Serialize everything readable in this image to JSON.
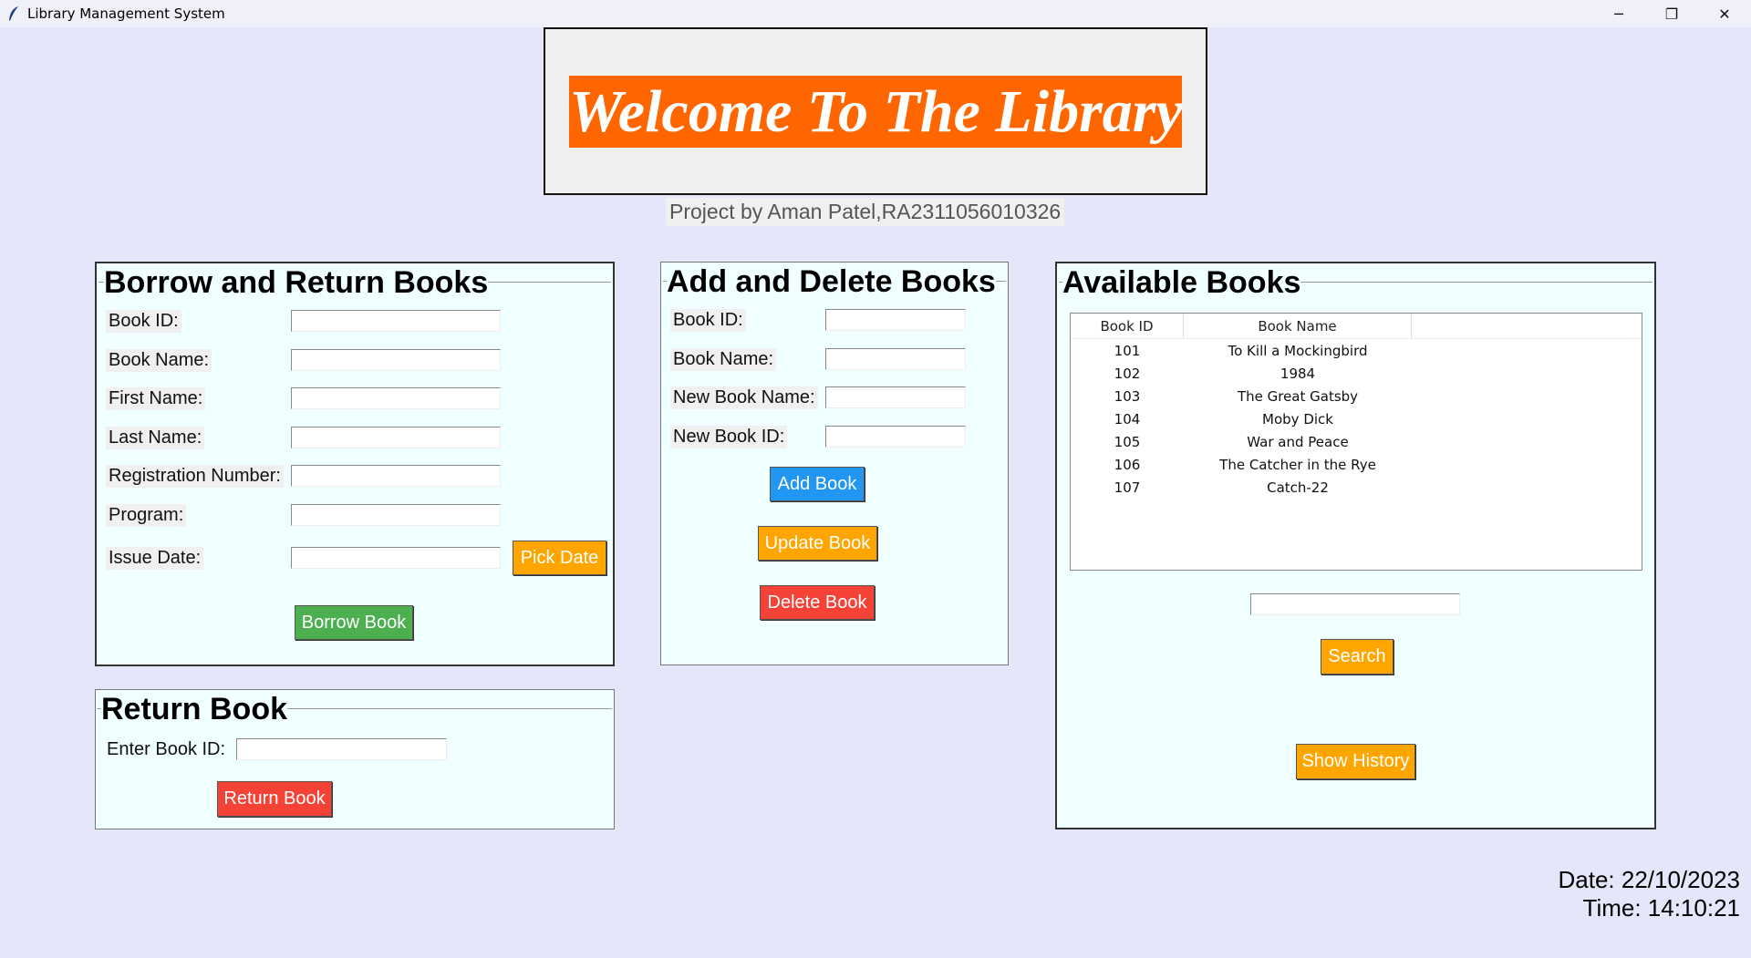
{
  "window": {
    "title": "Library Management System",
    "controls": {
      "minimize": "─",
      "restore": "❐",
      "close": "✕"
    }
  },
  "banner": {
    "title": "Welcome To The Library",
    "subtitle": "Project by Aman Patel,RA2311056010326"
  },
  "borrow_return": {
    "title": "Borrow and Return Books",
    "labels": {
      "book_id": "Book ID:",
      "book_name": "Book Name:",
      "first_name": "First Name:",
      "last_name": "Last Name:",
      "registration_number": "Registration Number:",
      "program": "Program:",
      "issue_date": "Issue Date:"
    },
    "values": {
      "book_id": "",
      "book_name": "",
      "first_name": "",
      "last_name": "",
      "registration_number": "",
      "program": "",
      "issue_date": ""
    },
    "pick_date_button": "Pick Date",
    "borrow_button": "Borrow Book"
  },
  "return_book": {
    "title": "Return Book",
    "label": "Enter Book ID:",
    "value": "",
    "button": "Return Book"
  },
  "add_delete": {
    "title": "Add and Delete Books",
    "labels": {
      "book_id": "Book ID:",
      "book_name": "Book Name:",
      "new_book_name": "New Book Name:",
      "new_book_id": "New Book ID:"
    },
    "values": {
      "book_id": "",
      "book_name": "",
      "new_book_name": "",
      "new_book_id": ""
    },
    "add_button": "Add Book",
    "update_button": "Update Book",
    "delete_button": "Delete Book"
  },
  "available_books": {
    "title": "Available Books",
    "columns": [
      "Book ID",
      "Book Name",
      ""
    ],
    "rows": [
      [
        "101",
        "To Kill a Mockingbird"
      ],
      [
        "102",
        "1984"
      ],
      [
        "103",
        "The Great Gatsby"
      ],
      [
        "104",
        "Moby Dick"
      ],
      [
        "105",
        "War and Peace"
      ],
      [
        "106",
        "The Catcher in the Rye"
      ],
      [
        "107",
        "Catch-22"
      ]
    ],
    "search_value": "",
    "search_button": "Search",
    "history_button": "Show History"
  },
  "status": {
    "date": "Date: 22/10/2023",
    "time": "Time: 14:10:21"
  },
  "colors": {
    "background": "#e6e6fa",
    "panel": "#f0ffff",
    "banner": "#ff6600",
    "orange_button": "#ffa500",
    "green_button": "#4caf50",
    "blue_button": "#2196f3",
    "red_button": "#f44336"
  }
}
